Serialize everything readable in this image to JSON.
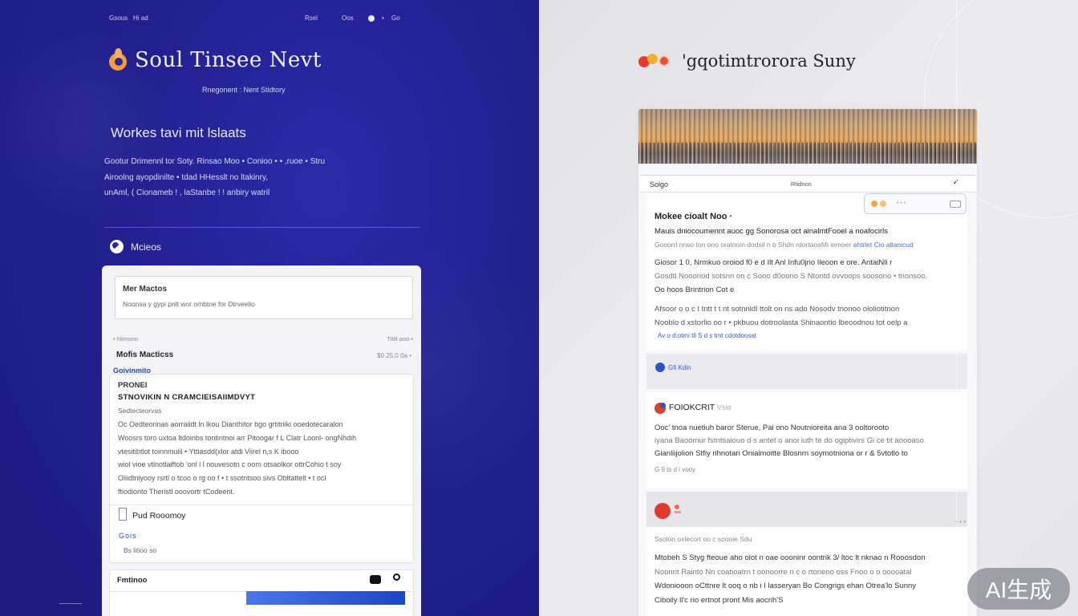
{
  "left": {
    "nav": [
      "Gsous",
      "Hi ad",
      "Rsel",
      "Oos",
      "Go"
    ],
    "brand": "Soul Tinsee Nevt",
    "brand_sub": "Rnegonent : Nent Stidtory",
    "hero_title": "Workes tavi mit lslaats",
    "hero_lines": [
      "Gootur  Drimennl tor   Soty. Rinsao Moo  •   Conioo  • • ,ruoe  •  Stru",
      "Airoolng  ayopdinilte • tdad HHesslt no ltakinry,",
      "unAml,  ( Cionameb ! ,  laStanbe  ! !   anbiry watril"
    ],
    "section_title": "Mcieos",
    "card": {
      "box_title": "Mer Mactos",
      "box_sub": "Noonsa y gypi pnlt wor ombtne for Dtrveelio",
      "meta_left": "•  Nirnono",
      "meta_right": "Titilt aoo  •",
      "title2": "Mofis Macticss",
      "price": "$0 25,0 0a  •",
      "tag": "Goivinmito",
      "panel_h1": "PRONEI",
      "panel_h2": "STNOVIKIN N CRAMCIEISAIIMDVYT",
      "panel_h3": "Sedtecteorvas",
      "panel_body": [
        "Oc  Oedteorinas  aorraiidt  ln   lkou  Dianthitor bgo  grtitriiki  ooedotecaralon",
        "Woosrs toro uxtoa ltdoinbs tontintnoi arr  Pitoogar  f L Clatr  Loonl- ongNhdih",
        "vtesitibtlot  toinnmulil  •  Yttiasdd(xlor atdi Viirel n,s K  ibooo",
        "wiol vioe vtlnotlaiftob  'onl l l nouvesotn c oom otsaolkor  ottrCohio t  soy",
        "Oliidtniyooy rsrtl o tcoo o rg oo f  •  t  ssotntsoo sivs Obltattelt •  t  ocl",
        "ftiodionto Theristl ooovortr tCodeent."
      ],
      "panel_product": "Pud Rooomoy",
      "panel_g1": "Gois",
      "panel_g2": "Bs  litioo so",
      "panel2_title": "Fmtinoo"
    }
  },
  "right": {
    "brand": "'gqotimtrorora Suny",
    "head_left": "Solgo",
    "head_mid": "Rtidnon",
    "head_x": "✓",
    "pill_text": "•  • •",
    "s1_title": "Mokee cioalt Noo ·",
    "s1_line1": "Mauis  dniocoumennt auoc gg  Sonorosa oct ainalmtFooel  a noafocirls",
    "s1_line2_a": "Gooorrl nrwo ton ono oratnoin  dodsil  n b Shdn rdortaoaMi   iemoer",
    "s1_line2_hl": "ahtrlet Cio atlanicud",
    "s1_body": [
      "Giosor 1 0,  Nrmkuo  oroiod  f0  e d  Ilt  Anl Infu0jrio Ileoon  e ore. AntaiNli r",
      "Gosdti  Noooriod  sotsnn on c Sooo d0oono S Ntontd ovvoops  soosono    •  trionsoo."
    ],
    "s1_body_last": "Oo  hoos Brintrion Cot e",
    "s1_body2": [
      "Afsoor  o o c I tntt t t nt sotnnldl  ttolt  on ns  ado  Nosodv trionoo ololiotitnon",
      "Nooblo d xstorlio oo r  •  pkbuou dotroolasta Shinaontio lbeoodnou tot oelp  a"
    ],
    "s1_link": "Av o d:otmi  tll S  d s  tmt cdotdoosat",
    "s2_text": "Gfi Kdin",
    "s3_title": "FOIOKCRIT",
    "s3_title_suffix": "Vsio",
    "s3_body": [
      "Ooc' tnoa nuetiuh baror  Sterue, Pai ono Noutnioreita ana 3 ooltorooto",
      "iyana  Baoomur fstntsaiouo d s antet o anoi iuth te do ogiptivirs  Gi ce tit aoooaso",
      "Gianliijolion Stfiy rihnotan Oniaimoitte Blosnrn soymotniona  or r & 5vtotlo to"
    ],
    "s3_foot": "G   9 ts  d i vooy",
    "s4_k": "•  •  •",
    "s5_sub": "Ssolon  oxlecort oo c soooie  Sdu",
    "s5_body": [
      "Mtobeh S Styg fteoue aho olot  n oae  oooninr oontrik 3/ ltoc lt nknao n Rooosdon",
      "Noonrit Rainto  Nn  coatioatrn t  oonoorre n c  o rtoneno oss  Fnoo   o o ooooatal",
      "Wdoniooon oCttnre  lt ooq o nb i I lasseryan Bo Congrigs ehan Otrea'lo Sunny",
      "Ciboily ll'c rio ertnot  pront  Mis aocrih'S"
    ]
  },
  "badge": "AI生成",
  "colors": {
    "left_bg": "#22208f",
    "accent_orange": "#f39a3c",
    "accent_red": "#e83a2a",
    "link_blue": "#3a5cc8"
  }
}
